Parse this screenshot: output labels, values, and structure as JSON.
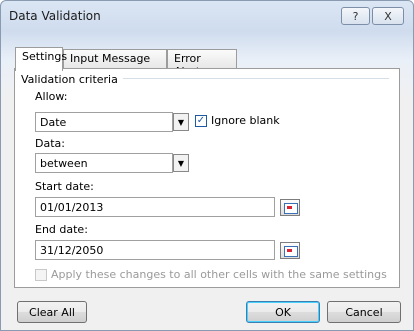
{
  "dialog": {
    "title": "Data Validation",
    "help_glyph": "?",
    "close_glyph": "X"
  },
  "tabs": [
    {
      "label": "Settings",
      "active": true
    },
    {
      "label": "Input Message",
      "active": false
    },
    {
      "label": "Error Alert",
      "active": false
    }
  ],
  "criteria": {
    "group_label": "Validation criteria",
    "allow_label": "Allow:",
    "allow_value": "Date",
    "ignore_blank_label": "Ignore blank",
    "ignore_blank_checked": true,
    "data_label": "Data:",
    "data_value": "between",
    "start_label": "Start date:",
    "start_value": "01/01/2013",
    "end_label": "End date:",
    "end_value": "31/12/2050"
  },
  "apply_all": {
    "label": "Apply these changes to all other cells with the same settings",
    "checked": false,
    "enabled": false
  },
  "buttons": {
    "clear_all": "Clear All",
    "ok": "OK",
    "cancel": "Cancel"
  },
  "icons": {
    "dropdown": "chevron-down-icon",
    "range_picker": "range-select-icon",
    "help": "help-icon",
    "close": "close-icon"
  }
}
